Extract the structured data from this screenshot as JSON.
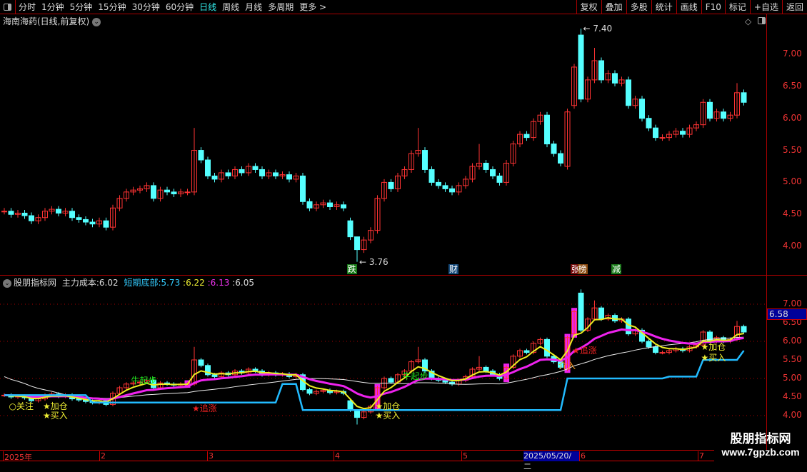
{
  "toolbar": {
    "periods": [
      "分时",
      "1分钟",
      "5分钟",
      "15分钟",
      "30分钟",
      "60分钟",
      "日线",
      "周线",
      "月线",
      "多周期",
      "更多 >"
    ],
    "active": "日线",
    "buttons": [
      "复权",
      "叠加",
      "多股",
      "统计",
      "画线",
      "F10",
      "标记",
      "+自选",
      "返回"
    ]
  },
  "main": {
    "title": "海南海药(日线,前复权)",
    "high_label": "7.40",
    "low_label": "3.76",
    "y_ticks": [
      "7.00",
      "6.50",
      "6.00",
      "5.50",
      "5.00",
      "4.50",
      "4.00"
    ],
    "signals": [
      {
        "text": "跌",
        "index": 51,
        "color": "#1a7a1a"
      },
      {
        "text": "财",
        "index": 66,
        "color": "#164a7a"
      },
      {
        "text": "张",
        "index": 84,
        "color": "#7a1010"
      },
      {
        "text": "榜",
        "index": 85,
        "color": "#8a4a10"
      },
      {
        "text": "减",
        "index": 90,
        "color": "#1a7a1a"
      }
    ]
  },
  "indicator": {
    "name": "股朋指标网",
    "label1": "主力成本:",
    "v1": "6.02",
    "label2": "短期底部:",
    "v2": "5.73",
    "v3": "6.22",
    "v4": "6.13",
    "v5": "6.05",
    "sep": ":",
    "y_ticks": [
      "7.00",
      "6.50",
      "6.00",
      "5.50",
      "5.00",
      "4.50",
      "4.00"
    ],
    "current": "6.58",
    "annotations": [
      {
        "text": "○关注",
        "index": 1,
        "price": 4.25,
        "color": "#ee3"
      },
      {
        "text": "★加仓",
        "index": 6,
        "price": 4.25,
        "color": "#ee3"
      },
      {
        "text": "★买入",
        "index": 6,
        "price": 4.0,
        "color": "#ee3"
      },
      {
        "text": "★追涨",
        "index": 28,
        "price": 4.2,
        "color": "#e22"
      },
      {
        "text": "牛起步",
        "index": 19,
        "price": 4.95,
        "color": "#2e2"
      },
      {
        "text": "★加仓",
        "index": 55,
        "price": 4.25,
        "color": "#ee3"
      },
      {
        "text": "★买入",
        "index": 55,
        "price": 4.0,
        "color": "#ee3"
      },
      {
        "text": "牛起步",
        "index": 59,
        "price": 5.05,
        "color": "#2e2"
      },
      {
        "text": "介入",
        "index": 82,
        "price": 5.35,
        "color": "#e92"
      },
      {
        "text": "★追涨",
        "index": 84,
        "price": 5.75,
        "color": "#e22"
      },
      {
        "text": "★加仓",
        "index": 103,
        "price": 5.85,
        "color": "#ee3"
      },
      {
        "text": "★买入",
        "index": 103,
        "price": 5.55,
        "color": "#ee3"
      }
    ]
  },
  "chart_data": {
    "type": "candlestick",
    "closes": [
      4.55,
      4.5,
      4.52,
      4.48,
      4.4,
      4.45,
      4.55,
      4.58,
      4.52,
      4.55,
      4.45,
      4.42,
      4.38,
      4.35,
      4.4,
      4.3,
      4.6,
      4.75,
      4.85,
      4.88,
      4.9,
      4.95,
      4.75,
      4.88,
      4.85,
      4.82,
      4.85,
      4.85,
      5.5,
      5.35,
      5.1,
      5.05,
      5.15,
      5.1,
      5.2,
      5.15,
      5.25,
      5.2,
      5.1,
      5.15,
      5.1,
      5.12,
      5.05,
      5.1,
      4.7,
      4.6,
      4.65,
      4.68,
      4.62,
      4.65,
      4.6,
      4.15,
      3.95,
      4.1,
      4.25,
      4.75,
      5.0,
      4.9,
      5.1,
      5.2,
      5.45,
      5.5,
      5.2,
      5.0,
      4.95,
      4.9,
      4.85,
      4.95,
      5.05,
      5.25,
      5.3,
      5.2,
      5.1,
      5.0,
      5.3,
      5.6,
      5.75,
      5.7,
      5.95,
      6.05,
      5.6,
      5.45,
      5.3,
      6.1,
      6.8,
      6.3,
      6.6,
      6.9,
      6.6,
      6.7,
      6.55,
      6.6,
      6.2,
      6.3,
      6.0,
      5.85,
      5.7,
      5.7,
      5.75,
      5.8,
      5.75,
      5.85,
      5.9,
      6.25,
      6.0,
      6.1,
      6.0,
      6.05,
      6.4,
      6.25
    ],
    "open_overrides": {
      "51": 4.4,
      "83": 5.25,
      "84": 6.2,
      "85": 7.3,
      "28": 4.85
    },
    "high_overrides": {
      "28": 5.85,
      "61": 5.85,
      "70": 5.6,
      "80": 6.1,
      "85": 7.4,
      "87": 7.1,
      "108": 6.55,
      "52": 4.1
    },
    "low_overrides": {
      "52": 3.76
    },
    "bottom_line": [
      [
        0,
        4.55
      ],
      [
        13,
        4.35
      ],
      [
        41,
        4.85
      ],
      [
        44,
        4.15
      ],
      [
        80,
        4.15
      ],
      [
        83,
        5.0
      ],
      [
        98,
        5.05
      ],
      [
        103,
        5.5
      ],
      [
        109,
        5.75
      ]
    ],
    "highlight_bars": [
      27,
      55,
      74,
      83,
      84
    ],
    "ylim_main": [
      3.6,
      7.45
    ],
    "ylim_indicator": [
      3.9,
      7.3
    ]
  }
}
